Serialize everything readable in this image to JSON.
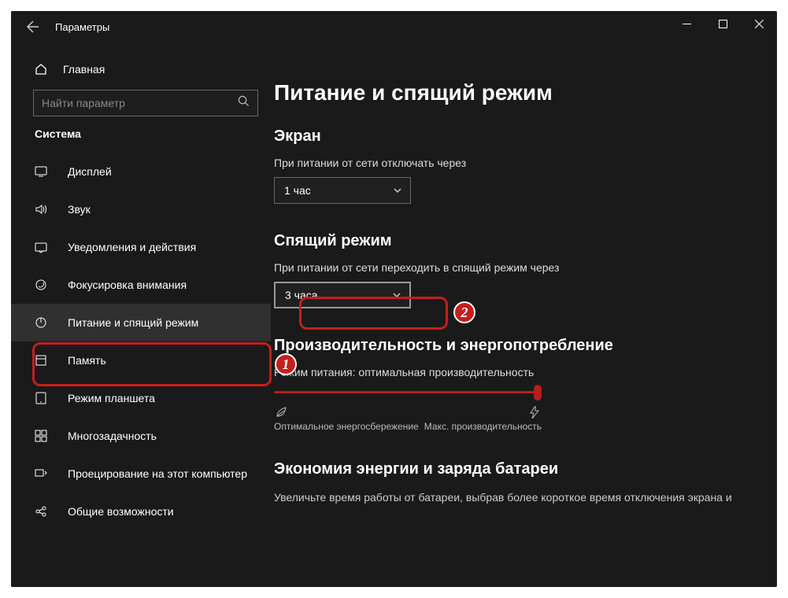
{
  "app": {
    "title": "Параметры"
  },
  "sidebar": {
    "home": "Главная",
    "searchPlaceholder": "Найти параметр",
    "category": "Система",
    "items": [
      {
        "icon": "display-icon",
        "label": "Дисплей"
      },
      {
        "icon": "sound-icon",
        "label": "Звук"
      },
      {
        "icon": "notifications-icon",
        "label": "Уведомления и действия"
      },
      {
        "icon": "focus-icon",
        "label": "Фокусировка внимания"
      },
      {
        "icon": "power-icon",
        "label": "Питание и спящий режим"
      },
      {
        "icon": "storage-icon",
        "label": "Память"
      },
      {
        "icon": "tablet-icon",
        "label": "Режим планшета"
      },
      {
        "icon": "multitask-icon",
        "label": "Многозадачность"
      },
      {
        "icon": "project-icon",
        "label": "Проецирование на этот компьютер"
      },
      {
        "icon": "shared-icon",
        "label": "Общие возможности"
      }
    ],
    "activeIndex": 4
  },
  "main": {
    "title": "Питание и спящий режим",
    "screen": {
      "heading": "Экран",
      "label": "При питании от сети отключать через",
      "value": "1 час"
    },
    "sleep": {
      "heading": "Спящий режим",
      "label": "При питании от сети переходить в спящий режим через",
      "value": "3 часа"
    },
    "perf": {
      "heading": "Производительность и энергопотребление",
      "modeLabel": "Режим питания: оптимальная производительность",
      "left": "Оптимальное энергосбережение",
      "right": "Макс. производительность"
    },
    "battery": {
      "heading": "Экономия энергии и заряда батареи",
      "desc": "Увеличьте время работы от батареи, выбрав более короткое время отключения экрана и"
    }
  },
  "markers": {
    "one": "1",
    "two": "2"
  }
}
